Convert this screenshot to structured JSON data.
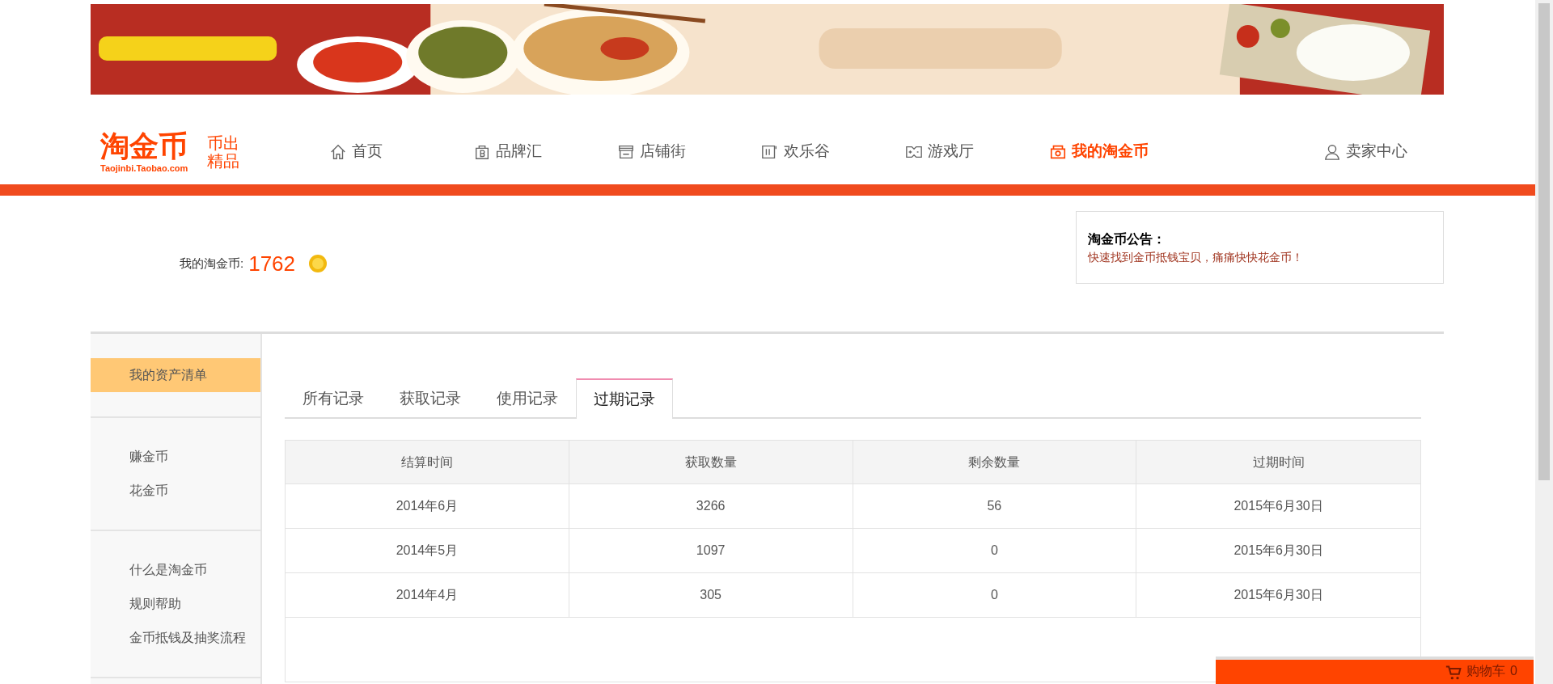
{
  "banner": {
    "kind": "picture"
  },
  "logo": {
    "name": "淘金币",
    "url": "Taojinbi.Taobao.com",
    "slogan_1": "币出",
    "slogan_2": "精品"
  },
  "nav": [
    {
      "label": "首页",
      "selected": false
    },
    {
      "label": "品牌汇",
      "selected": false
    },
    {
      "label": "店铺街",
      "selected": false
    },
    {
      "label": "欢乐谷",
      "selected": false
    },
    {
      "label": "游戏厅",
      "selected": false
    },
    {
      "label": "我的淘金币",
      "selected": true
    }
  ],
  "seller_center": "卖家中心",
  "balance": {
    "label": "我的淘金币:",
    "value": "1762"
  },
  "notice": {
    "title": "淘金币公告：",
    "text": "快速找到金币抵钱宝贝，痛痛快快花金币！"
  },
  "sidebar": [
    [
      {
        "label": "我的资产清单",
        "selected": true
      }
    ],
    [
      {
        "label": "赚金币",
        "selected": false
      },
      {
        "label": "花金币",
        "selected": false
      }
    ],
    [
      {
        "label": "什么是淘金币",
        "selected": false
      },
      {
        "label": "规则帮助",
        "selected": false
      },
      {
        "label": "金币抵钱及抽奖流程",
        "selected": false
      }
    ]
  ],
  "tabs": [
    {
      "label": "所有记录",
      "selected": false
    },
    {
      "label": "获取记录",
      "selected": false
    },
    {
      "label": "使用记录",
      "selected": false
    },
    {
      "label": "过期记录",
      "selected": true
    }
  ],
  "table": {
    "columns": [
      "结算时间",
      "获取数量",
      "剩余数量",
      "过期时间"
    ],
    "rows": [
      [
        "2014年6月",
        "3266",
        "56",
        "2015年6月30日"
      ],
      [
        "2014年5月",
        "1097",
        "0",
        "2015年6月30日"
      ],
      [
        "2014年4月",
        "305",
        "0",
        "2015年6月30日"
      ]
    ]
  },
  "cart": {
    "label": "购物车",
    "count": "0"
  }
}
